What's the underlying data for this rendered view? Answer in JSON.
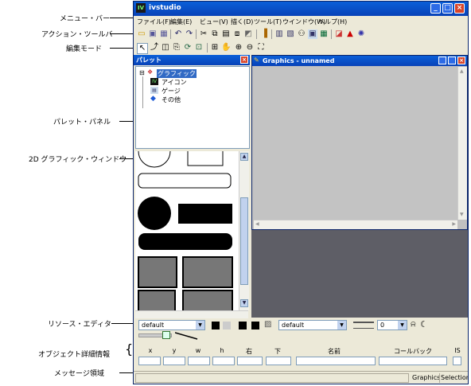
{
  "callouts": {
    "menubar": "メニュー・バー",
    "toolbar": "アクション・ツールバー",
    "editmode": "編集モード",
    "palette": "パレット・パネル",
    "graphics": "2D グラフィック・ウィンドウ",
    "resource": "リソース・エディタ",
    "objectinfo": "オブジェクト詳細情報",
    "message": "メッセージ領域"
  },
  "app": {
    "title": "ivstudio",
    "logo": "IV"
  },
  "menu": [
    "ファイル(F)",
    "編集(E)",
    "ビュー(V)",
    "描く(D)",
    "ツール(T)",
    "ウインドウ(W)",
    "ヘルプ(H)"
  ],
  "palette": {
    "title": "パレット",
    "root": "グラフィック",
    "children": [
      "アイコン",
      "ゲージ",
      "その他"
    ]
  },
  "graphics": {
    "title": "Graphics - unnamed"
  },
  "resource": {
    "select1": "default",
    "select2": "default",
    "select3": "0"
  },
  "object_info": {
    "columns": [
      "x",
      "y",
      "w",
      "h",
      "右",
      "下",
      "名前",
      "コールバック",
      "IS"
    ]
  },
  "status": {
    "graphics": "Graphics",
    "selection": "Selection"
  }
}
